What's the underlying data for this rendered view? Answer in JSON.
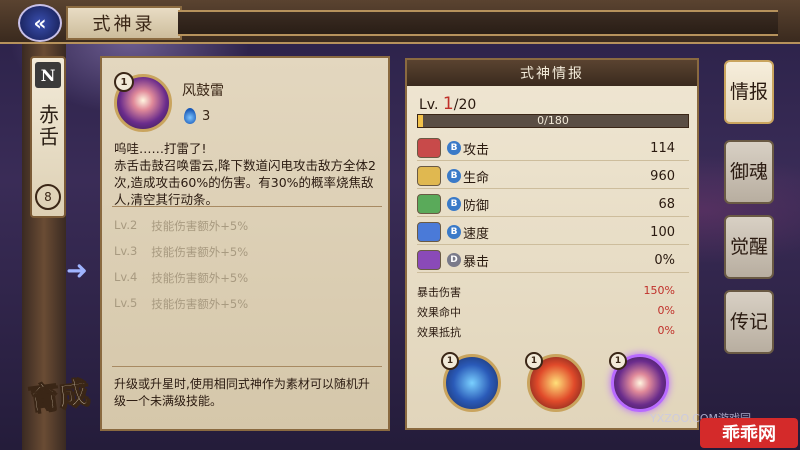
{
  "header": {
    "title": "式神录"
  },
  "colors": {
    "accent_red": "#c0302a",
    "frame_gold": "#c9a45e"
  },
  "shikigami": {
    "rank": "N",
    "name": "赤舌",
    "level": "8"
  },
  "grow_button": "育成",
  "skill": {
    "level": "1",
    "name": "风鼓雷",
    "cost": "3",
    "description": "呜哇……打雷了!\n赤舌击鼓召唤雷云,降下数道闪电攻击敌方全体2次,造成攻击60%的伤害。有30%的概率烧焦敌人,清空其行动条。",
    "upgrades": [
      {
        "lv": "Lv.2",
        "text": "技能伤害额外+5%"
      },
      {
        "lv": "Lv.3",
        "text": "技能伤害额外+5%"
      },
      {
        "lv": "Lv.4",
        "text": "技能伤害额外+5%"
      },
      {
        "lv": "Lv.5",
        "text": "技能伤害额外+5%"
      }
    ],
    "upgrade_note": "升级或升星时,使用相同式神作为素材可以随机升级一个未满级技能。"
  },
  "info": {
    "header": "式神情报",
    "lv_label": "Lv.",
    "lv_current": "1",
    "lv_max": "/20",
    "exp": "0/180",
    "exp_fraction": 0.02,
    "stats": [
      {
        "grade": "B",
        "name": "攻击",
        "value": "114"
      },
      {
        "grade": "B",
        "name": "生命",
        "value": "960"
      },
      {
        "grade": "B",
        "name": "防御",
        "value": "68"
      },
      {
        "grade": "B",
        "name": "速度",
        "value": "100"
      },
      {
        "grade": "D",
        "name": "暴击",
        "value": "0%"
      }
    ],
    "sub_stats": [
      {
        "name": "暴击伤害",
        "value": "150%"
      },
      {
        "name": "效果命中",
        "value": "0%"
      },
      {
        "name": "效果抵抗",
        "value": "0%"
      }
    ],
    "skill_slots": [
      {
        "level": "1"
      },
      {
        "level": "1"
      },
      {
        "level": "1"
      }
    ]
  },
  "tabs": [
    {
      "label": "情报",
      "active": true
    },
    {
      "label": "御魂",
      "active": false
    },
    {
      "label": "觉醒",
      "active": false
    },
    {
      "label": "传记",
      "active": false
    }
  ],
  "watermarks": {
    "site": "YXZOO.COM游戏园",
    "logo": "乖乖网"
  }
}
